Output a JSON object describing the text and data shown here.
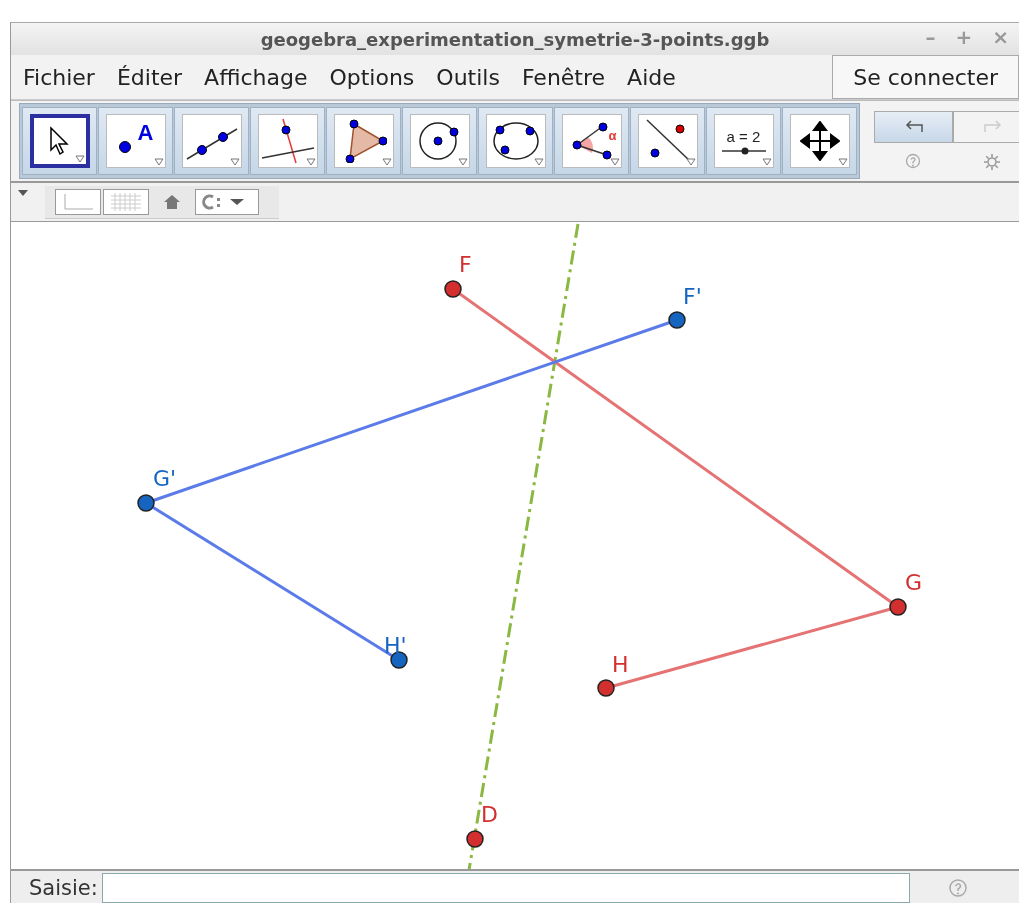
{
  "window": {
    "title": "geogebra_experimentation_symetrie-3-points.ggb",
    "controls": [
      "–",
      "+",
      "×"
    ]
  },
  "menu": [
    "Fichier",
    "Éditer",
    "Affichage",
    "Options",
    "Outils",
    "Fenêtre",
    "Aide"
  ],
  "login": "Se connecter",
  "tools": [
    {
      "kind": "move",
      "selected": true
    },
    {
      "kind": "point",
      "text": "A",
      "selected": false
    },
    {
      "kind": "line",
      "selected": false
    },
    {
      "kind": "perpendicular",
      "selected": false
    },
    {
      "kind": "polygon",
      "selected": false
    },
    {
      "kind": "circle",
      "selected": false
    },
    {
      "kind": "ellipse",
      "selected": false
    },
    {
      "kind": "angle",
      "text": "α",
      "selected": false
    },
    {
      "kind": "reflect",
      "selected": false
    },
    {
      "kind": "slider",
      "text": "a = 2",
      "selected": false
    },
    {
      "kind": "pan",
      "selected": false
    }
  ],
  "undo": {
    "disabled": false
  },
  "redo": {
    "disabled": true
  },
  "points": [
    {
      "label": "F",
      "color": "#d32f2f"
    },
    {
      "label": "F'",
      "color": "#1565c0"
    },
    {
      "label": "G'",
      "color": "#1565c0"
    },
    {
      "label": "H'",
      "color": "#1565c0"
    },
    {
      "label": "G",
      "color": "#d32f2f"
    },
    {
      "label": "H",
      "color": "#d32f2f"
    },
    {
      "label": "D",
      "color": "#d32f2f"
    }
  ],
  "segments": [
    {
      "color": "#e57373"
    },
    {
      "color": "#e57373"
    },
    {
      "color": "#5b7be8"
    },
    {
      "color": "#5b7be8"
    }
  ],
  "axis": {
    "color": "#8ab840"
  },
  "input": {
    "label": "Saisie:"
  }
}
